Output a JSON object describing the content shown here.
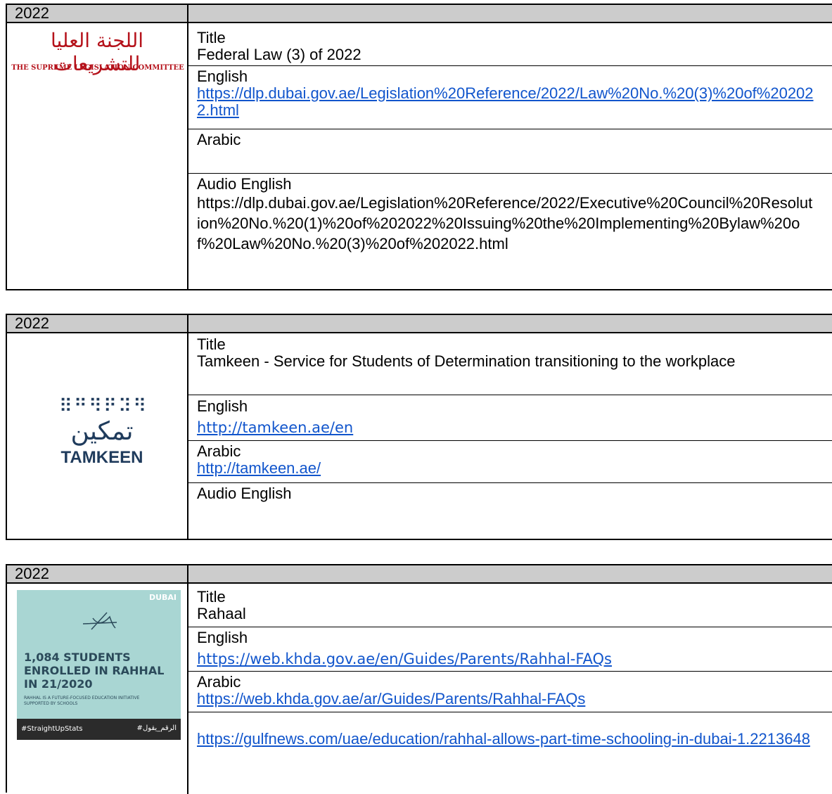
{
  "tables": [
    {
      "year": "2022",
      "logo": {
        "arabic": "اللجنة العليا للتشريعات",
        "english": "THE SUPREME LEGISLATION COMMITTEE",
        "color": "#b5121b"
      },
      "title_label": "Title",
      "title_value": "Federal Law (3) of 2022",
      "english_label": "English",
      "english_link": "https://dlp.dubai.gov.ae/Legislation%20Reference/2022/Law%20No.%20(3)%20of%202022.html",
      "arabic_label": "Arabic",
      "audio_label": "Audio English",
      "audio_text": "https://dlp.dubai.gov.ae/Legislation%20Reference/2022/Executive%20Council%20Resolution%20No.%20(1)%20of%202022%20Issuing%20the%20Implementing%20Bylaw%20of%20Law%20No.%20(3)%20of%202022.html"
    },
    {
      "year": "2022",
      "logo": {
        "arabic": "تمكين",
        "english": "TAMKEEN",
        "color": "#1f3b5c"
      },
      "title_label": "Title",
      "title_value": "Tamkeen - Service for Students of Determination transitioning to the workplace",
      "english_label": "English",
      "english_link": "http://tamkeen.ae/en",
      "arabic_label": "Arabic",
      "arabic_link": "http://tamkeen.ae/",
      "audio_label": "Audio English"
    },
    {
      "year": "2022",
      "logo": {
        "brand": "DUBAI",
        "headline": "1,084 STUDENTS ENROLLED IN RAHHAL IN 21/2020",
        "subline": "RAHHAL IS A FUTURE-FOCUSED EDUCATION INITIATIVE SUPPORTED BY SCHOOLS",
        "tag_left": "#StraightUpStats",
        "tag_right": "#الرقم_يقول",
        "bg": "#a9d6d3"
      },
      "title_label": "Title",
      "title_value": "Rahaal",
      "english_label": "English",
      "english_link": "https://web.khda.gov.ae/en/Guides/Parents/Rahhal-FAQs",
      "arabic_label": "Arabic",
      "arabic_link": "https://web.khda.gov.ae/ar/Guides/Parents/Rahhal-FAQs",
      "extra_link": "https://gulfnews.com/uae/education/rahhal-allows-part-time-schooling-in-dubai-1.2213648"
    }
  ]
}
